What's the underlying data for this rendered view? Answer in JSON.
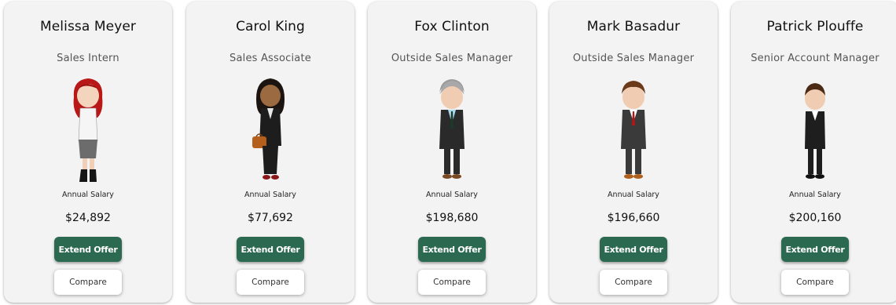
{
  "salary_label": "Annual Salary",
  "offer_button_label": "Extend Offer",
  "compare_button_label": "Compare",
  "colors": {
    "offer_button": "#2b6a50",
    "card_background": "#f3f3f3"
  },
  "candidates": [
    {
      "name": "Melissa Meyer",
      "title": "Sales Intern",
      "salary": "$24,892",
      "avatar_icon": "female-red-hair-avatar-icon"
    },
    {
      "name": "Carol King",
      "title": "Sales Associate",
      "salary": "$77,692",
      "avatar_icon": "female-briefcase-avatar-icon"
    },
    {
      "name": "Fox Clinton",
      "title": "Outside Sales Manager",
      "salary": "$198,680",
      "avatar_icon": "male-gray-hair-avatar-icon"
    },
    {
      "name": "Mark Basadur",
      "title": "Outside Sales Manager",
      "salary": "$196,660",
      "avatar_icon": "male-brown-hair-avatar-icon"
    },
    {
      "name": "Patrick Plouffe",
      "title": "Senior Account Manager",
      "salary": "$200,160",
      "avatar_icon": "male-dark-suit-avatar-icon"
    }
  ]
}
